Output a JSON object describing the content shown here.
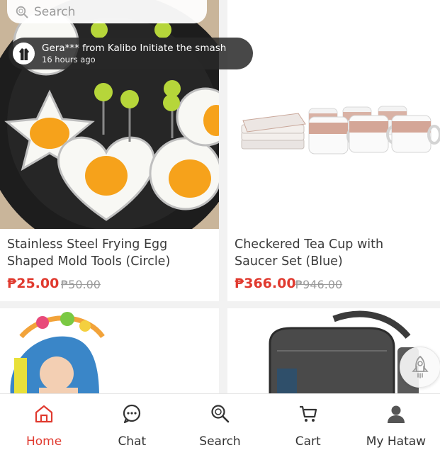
{
  "search": {
    "placeholder": "Search"
  },
  "toast": {
    "line1": "Gera*** from Kalibo Initiate the smash",
    "line2": "16 hours ago"
  },
  "products": [
    {
      "title": "Stainless Steel Frying Egg Shaped Mold Tools (Circle)",
      "price": "₱25.00",
      "old_price": "₱50.00"
    },
    {
      "title": "Checkered Tea Cup with Saucer Set (Blue)",
      "price": "₱366.00",
      "old_price": "₱946.00"
    }
  ],
  "nav": {
    "items": [
      {
        "label": "Home",
        "icon": "home-icon",
        "active": true
      },
      {
        "label": "Chat",
        "icon": "chat-icon",
        "active": false
      },
      {
        "label": "Search",
        "icon": "search-icon",
        "active": false
      },
      {
        "label": "Cart",
        "icon": "cart-icon",
        "active": false
      },
      {
        "label": "My Hataw",
        "icon": "user-icon",
        "active": false
      }
    ]
  },
  "colors": {
    "accent": "#e03a2f",
    "toast_bg": "#282828"
  }
}
